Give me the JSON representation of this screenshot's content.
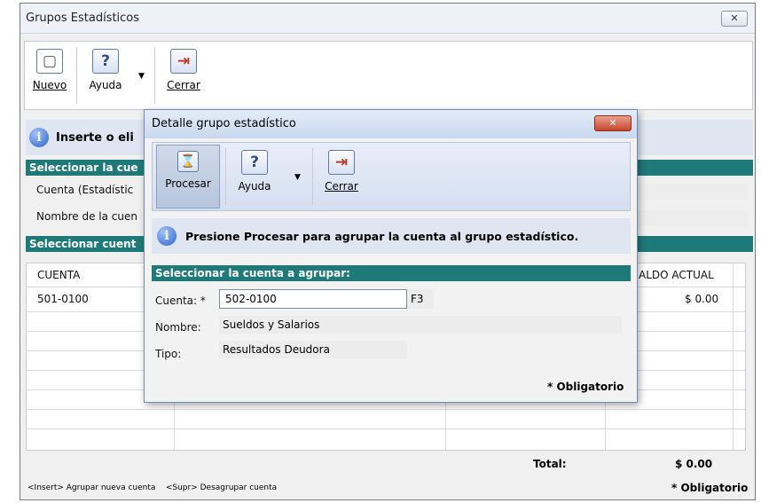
{
  "window": {
    "title": "Grupos Estadísticos",
    "close_label": "✕"
  },
  "toolbar": {
    "nuevo": "Nuevo",
    "ayuda": "Ayuda",
    "cerrar": "Cerrar"
  },
  "info": {
    "text": "Inserte o eli"
  },
  "section1": {
    "header": "Seleccionar la cue",
    "cuenta_label": "Cuenta (Estadístic",
    "nombre_label": "Nombre de la cuen"
  },
  "section2": {
    "header": "Seleccionar cuent"
  },
  "grid": {
    "col_cuenta": "CUENTA",
    "col_saldo": "ALDO ACTUAL",
    "rows": [
      {
        "cuenta": "501-0100",
        "saldo": "$ 0.00"
      }
    ]
  },
  "footer": {
    "total_label": "Total:",
    "total_value": "$ 0.00",
    "shortcuts": "<Insert> Agrupar nueva cuenta    <Supr> Desagrupar cuenta",
    "obligatorio": "* Obligatorio"
  },
  "dialog": {
    "title": "Detalle grupo estadístico",
    "close_label": "✕",
    "toolbar": {
      "procesar": "Procesar",
      "ayuda": "Ayuda",
      "cerrar": "Cerrar"
    },
    "info": "Presione Procesar para agrupar la cuenta al grupo estadístico.",
    "section_header": "Seleccionar la cuenta a agrupar:",
    "cuenta_label": "Cuenta: *",
    "cuenta_value": "502-0100",
    "f3_label": "F3",
    "nombre_label": "Nombre:",
    "nombre_value": "Sueldos y Salarios",
    "tipo_label": "Tipo:",
    "tipo_value": "Resultados Deudora",
    "obligatorio": "* Obligatorio"
  },
  "icons": {
    "nuevo": "new-document-icon",
    "ayuda": "help-icon",
    "cerrar": "exit-door-icon",
    "procesar": "hourglass-icon",
    "info": "info-icon",
    "dropdown": "chevron-down-icon"
  }
}
